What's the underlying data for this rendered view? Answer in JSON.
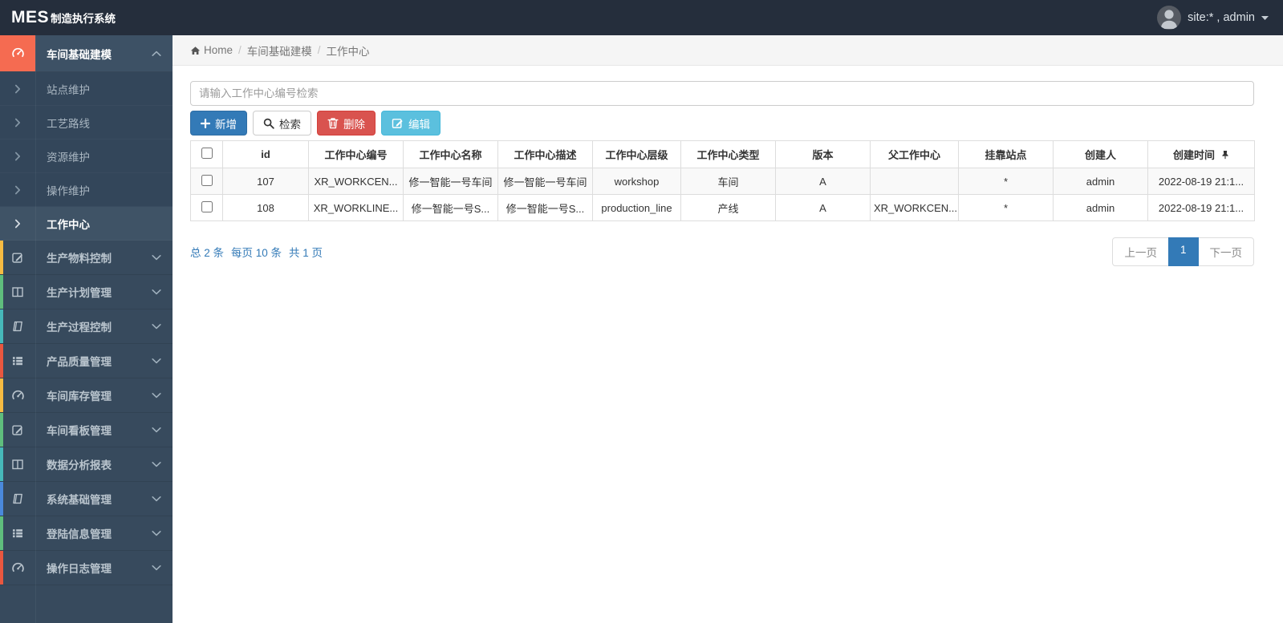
{
  "colors": {
    "topbar_bg": "#252e3c",
    "sidebar_bg": "#374a5d",
    "submenu_bg": "#33465a",
    "active_accent": "#f56b51",
    "primary_blue": "#337ab7",
    "danger_red": "#d9534f",
    "info_blue": "#5bc0de",
    "stripe_gray": "#f9f9f9"
  },
  "topbar": {
    "logo_main": "MES",
    "logo_sub": "制造执行系统",
    "user": "site:* , admin",
    "user_icons": [
      "avatar",
      "caret-down-icon"
    ]
  },
  "breadcrumb": {
    "home_icon": "home-icon",
    "home": "Home",
    "items": [
      "车间基础建模",
      "工作中心"
    ]
  },
  "sidebar": {
    "groups": [
      {
        "label": "车间基础建模",
        "icon": "gauge-icon",
        "accent": "#f56b51",
        "expanded": true,
        "active": true,
        "children": [
          {
            "label": "站点维护",
            "active": false
          },
          {
            "label": "工艺路线",
            "active": false
          },
          {
            "label": "资源维护",
            "active": false
          },
          {
            "label": "操作维护",
            "active": false
          },
          {
            "label": "工作中心",
            "active": true
          }
        ]
      },
      {
        "label": "生产物料控制",
        "icon": "pencil-square-icon",
        "accent": "#f6bb42"
      },
      {
        "label": "生产计划管理",
        "icon": "columns-icon",
        "accent": "#5fbe7d"
      },
      {
        "label": "生产过程控制",
        "icon": "book-icon",
        "accent": "#46b8ba"
      },
      {
        "label": "产品质量管理",
        "icon": "list-icon",
        "accent": "#e9573f"
      },
      {
        "label": "车间库存管理",
        "icon": "gauge-icon",
        "accent": "#f6bb42"
      },
      {
        "label": "车间看板管理",
        "icon": "pencil-square-icon",
        "accent": "#5fbe7d"
      },
      {
        "label": "数据分析报表",
        "icon": "columns-icon",
        "accent": "#46b8ba"
      },
      {
        "label": "系统基础管理",
        "icon": "book-icon",
        "accent": "#4a89dc"
      },
      {
        "label": "登陆信息管理",
        "icon": "list-icon",
        "accent": "#5fbe7d"
      },
      {
        "label": "操作日志管理",
        "icon": "gauge-icon",
        "accent": "#e9573f"
      }
    ]
  },
  "search": {
    "placeholder": "请输入工作中心编号检索",
    "value": ""
  },
  "toolbar": {
    "add": {
      "label": "新增",
      "icon": "plus-icon"
    },
    "search": {
      "label": "检索",
      "icon": "search-icon"
    },
    "delete": {
      "label": "删除",
      "icon": "trash-icon"
    },
    "edit": {
      "label": "编辑",
      "icon": "edit-icon"
    }
  },
  "table": {
    "columns": [
      "id",
      "工作中心编号",
      "工作中心名称",
      "工作中心描述",
      "工作中心层级",
      "工作中心类型",
      "版本",
      "父工作中心",
      "挂靠站点",
      "创建人",
      "创建时间"
    ],
    "pin_icon": "pin-icon",
    "rows": [
      [
        "107",
        "XR_WORKCEN...",
        "修一智能一号车间",
        "修一智能一号车间",
        "workshop",
        "车间",
        "A",
        "",
        "*",
        "admin",
        "2022-08-19 21:1..."
      ],
      [
        "108",
        "XR_WORKLINE...",
        "修一智能一号S...",
        "修一智能一号S...",
        "production_line",
        "产线",
        "A",
        "XR_WORKCEN...",
        "*",
        "admin",
        "2022-08-19 21:1..."
      ]
    ]
  },
  "pagination": {
    "summary_total": "总 2 条",
    "summary_per_page": "每页 10 条",
    "summary_pages": "共 1 页",
    "prev": "上一页",
    "current": "1",
    "next": "下一页"
  }
}
